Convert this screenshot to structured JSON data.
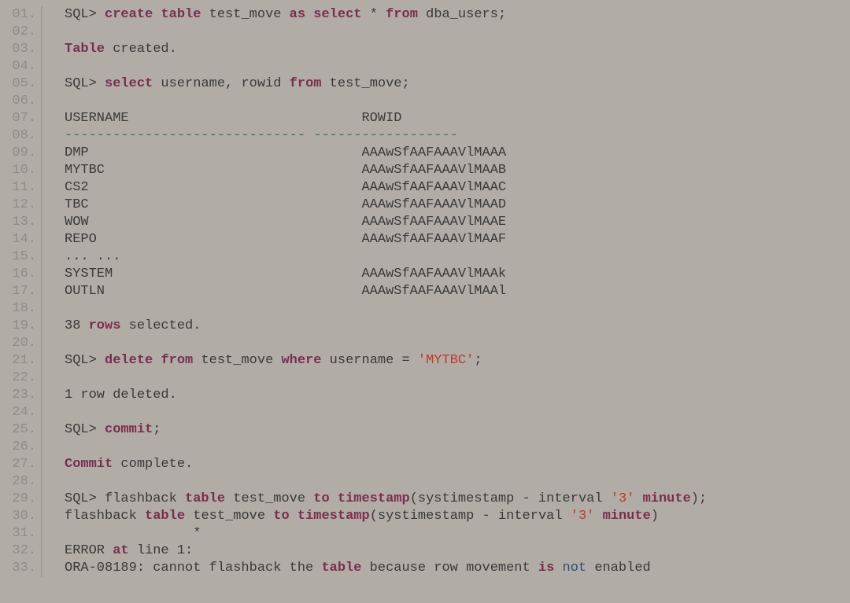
{
  "code": {
    "lines": [
      {
        "n": "01.",
        "segs": [
          [
            "",
            "SQL> "
          ],
          [
            "kw",
            "create"
          ],
          [
            "",
            " "
          ],
          [
            "kw",
            "table"
          ],
          [
            "",
            " test_move "
          ],
          [
            "kw",
            "as"
          ],
          [
            "",
            " "
          ],
          [
            "kw",
            "select"
          ],
          [
            "",
            " * "
          ],
          [
            "kw",
            "from"
          ],
          [
            "",
            " dba_users;"
          ]
        ]
      },
      {
        "n": "02.",
        "segs": [
          [
            "",
            ""
          ]
        ]
      },
      {
        "n": "03.",
        "segs": [
          [
            "kw",
            "Table"
          ],
          [
            "",
            " created."
          ]
        ]
      },
      {
        "n": "04.",
        "segs": [
          [
            "",
            ""
          ]
        ]
      },
      {
        "n": "05.",
        "segs": [
          [
            "",
            "SQL> "
          ],
          [
            "kw",
            "select"
          ],
          [
            "",
            " username, rowid "
          ],
          [
            "kw",
            "from"
          ],
          [
            "",
            " test_move;"
          ]
        ]
      },
      {
        "n": "06.",
        "segs": [
          [
            "",
            ""
          ]
        ]
      },
      {
        "n": "07.",
        "segs": [
          [
            "",
            "USERNAME                             ROWID"
          ]
        ]
      },
      {
        "n": "08.",
        "segs": [
          [
            "hdr",
            "------------------------------ ------------------"
          ]
        ]
      },
      {
        "n": "09.",
        "segs": [
          [
            "",
            "DMP                                  AAAwSfAAFAAAVlMAAA"
          ]
        ]
      },
      {
        "n": "10.",
        "segs": [
          [
            "",
            "MYTBC                                AAAwSfAAFAAAVlMAAB"
          ]
        ]
      },
      {
        "n": "11.",
        "segs": [
          [
            "",
            "CS2                                  AAAwSfAAFAAAVlMAAC"
          ]
        ]
      },
      {
        "n": "12.",
        "segs": [
          [
            "",
            "TBC                                  AAAwSfAAFAAAVlMAAD"
          ]
        ]
      },
      {
        "n": "13.",
        "segs": [
          [
            "",
            "WOW                                  AAAwSfAAFAAAVlMAAE"
          ]
        ]
      },
      {
        "n": "14.",
        "segs": [
          [
            "",
            "REPO                                 AAAwSfAAFAAAVlMAAF"
          ]
        ]
      },
      {
        "n": "15.",
        "segs": [
          [
            "",
            "... ..."
          ]
        ]
      },
      {
        "n": "16.",
        "segs": [
          [
            "",
            "SYSTEM                               AAAwSfAAFAAAVlMAAk"
          ]
        ]
      },
      {
        "n": "17.",
        "segs": [
          [
            "",
            "OUTLN                                AAAwSfAAFAAAVlMAAl"
          ]
        ]
      },
      {
        "n": "18.",
        "segs": [
          [
            "",
            ""
          ]
        ]
      },
      {
        "n": "19.",
        "segs": [
          [
            "",
            "38 "
          ],
          [
            "kw",
            "rows"
          ],
          [
            "",
            " selected."
          ]
        ]
      },
      {
        "n": "20.",
        "segs": [
          [
            "",
            ""
          ]
        ]
      },
      {
        "n": "21.",
        "segs": [
          [
            "",
            "SQL> "
          ],
          [
            "kw",
            "delete"
          ],
          [
            "",
            " "
          ],
          [
            "kw",
            "from"
          ],
          [
            "",
            " test_move "
          ],
          [
            "kw",
            "where"
          ],
          [
            "",
            " username = "
          ],
          [
            "str",
            "'MYTBC'"
          ],
          [
            "",
            ";"
          ]
        ]
      },
      {
        "n": "22.",
        "segs": [
          [
            "",
            ""
          ]
        ]
      },
      {
        "n": "23.",
        "segs": [
          [
            "",
            "1 row deleted."
          ]
        ]
      },
      {
        "n": "24.",
        "segs": [
          [
            "",
            ""
          ]
        ]
      },
      {
        "n": "25.",
        "segs": [
          [
            "",
            "SQL> "
          ],
          [
            "kw",
            "commit"
          ],
          [
            "",
            ";"
          ]
        ]
      },
      {
        "n": "26.",
        "segs": [
          [
            "",
            ""
          ]
        ]
      },
      {
        "n": "27.",
        "segs": [
          [
            "kw",
            "Commit"
          ],
          [
            "",
            " complete."
          ]
        ]
      },
      {
        "n": "28.",
        "segs": [
          [
            "",
            ""
          ]
        ]
      },
      {
        "n": "29.",
        "segs": [
          [
            "",
            "SQL> flashback "
          ],
          [
            "kw",
            "table"
          ],
          [
            "",
            " test_move "
          ],
          [
            "kw",
            "to"
          ],
          [
            "",
            " "
          ],
          [
            "kw",
            "timestamp"
          ],
          [
            "",
            "(systimestamp - interval "
          ],
          [
            "str",
            "'3'"
          ],
          [
            "",
            " "
          ],
          [
            "kw",
            "minute"
          ],
          [
            "",
            ");"
          ]
        ]
      },
      {
        "n": "30.",
        "segs": [
          [
            "",
            "flashback "
          ],
          [
            "kw",
            "table"
          ],
          [
            "",
            " test_move "
          ],
          [
            "kw",
            "to"
          ],
          [
            "",
            " "
          ],
          [
            "kw",
            "timestamp"
          ],
          [
            "",
            "(systimestamp - interval "
          ],
          [
            "str",
            "'3'"
          ],
          [
            "",
            " "
          ],
          [
            "kw",
            "minute"
          ],
          [
            "",
            ")"
          ]
        ]
      },
      {
        "n": "31.",
        "segs": [
          [
            "",
            "                *"
          ]
        ]
      },
      {
        "n": "32.",
        "segs": [
          [
            "",
            "ERROR "
          ],
          [
            "kw",
            "at"
          ],
          [
            "",
            " line 1:"
          ]
        ]
      },
      {
        "n": "33.",
        "segs": [
          [
            "",
            "ORA-08189: cannot flashback the "
          ],
          [
            "kw",
            "table"
          ],
          [
            "",
            " because row movement "
          ],
          [
            "kw",
            "is"
          ],
          [
            "",
            " "
          ],
          [
            "bool",
            "not"
          ],
          [
            "",
            " enabled"
          ]
        ]
      }
    ]
  }
}
